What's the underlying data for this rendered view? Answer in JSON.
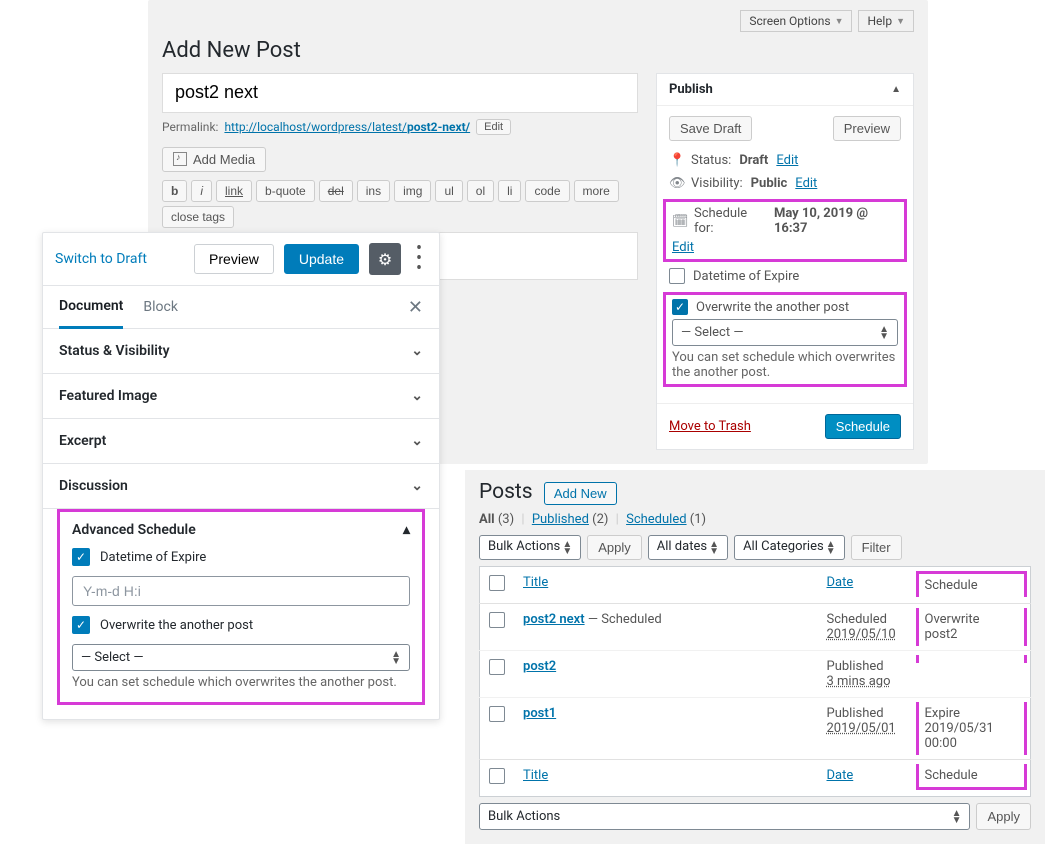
{
  "panel_a": {
    "screen_options": "Screen Options",
    "help": "Help",
    "heading": "Add New Post",
    "title_value": "post2 next",
    "permalink_label": "Permalink:",
    "permalink_base": "http://localhost/wordpress/latest/",
    "permalink_slug": "post2-next/",
    "permalink_edit": "Edit",
    "add_media": "Add Media",
    "quicktags": [
      "b",
      "i",
      "link",
      "b-quote",
      "del",
      "ins",
      "img",
      "ul",
      "ol",
      "li",
      "code",
      "more",
      "close tags"
    ],
    "publish": {
      "title": "Publish",
      "save_draft": "Save Draft",
      "preview": "Preview",
      "status_label": "Status:",
      "status_value": "Draft",
      "status_edit": "Edit",
      "visibility_label": "Visibility:",
      "visibility_value": "Public",
      "visibility_edit": "Edit",
      "schedule_label": "Schedule for:",
      "schedule_value": "May 10, 2019 @ 16:37",
      "schedule_edit": "Edit",
      "datetime_expire_label": "Datetime of Expire",
      "overwrite_label": "Overwrite the another post",
      "select_placeholder": "— Select —",
      "hint": "You can set schedule which overwrites the another post.",
      "move_trash": "Move to Trash",
      "schedule_btn": "Schedule"
    }
  },
  "panel_b": {
    "switch_draft": "Switch to Draft",
    "preview": "Preview",
    "update": "Update",
    "tab_document": "Document",
    "tab_block": "Block",
    "panels": [
      "Status & Visibility",
      "Featured Image",
      "Excerpt",
      "Discussion"
    ],
    "advanced": {
      "title": "Advanced Schedule",
      "datetime_expire_label": "Datetime of Expire",
      "datetime_placeholder": "Y-m-d H:i",
      "overwrite_label": "Overwrite the another post",
      "select_placeholder": "— Select —",
      "hint": "You can set schedule which overwrites the another post."
    }
  },
  "panel_c": {
    "heading": "Posts",
    "add_new": "Add New",
    "filter_all": "All",
    "filter_all_count": "(3)",
    "filter_published": "Published",
    "filter_published_count": "(2)",
    "filter_scheduled": "Scheduled",
    "filter_scheduled_count": "(1)",
    "bulk_actions": "Bulk Actions",
    "apply": "Apply",
    "all_dates": "All dates",
    "all_categories": "All Categories",
    "filter_btn": "Filter",
    "col_title": "Title",
    "col_date": "Date",
    "col_schedule": "Schedule",
    "rows": [
      {
        "title": "post2 next",
        "state": "— Scheduled",
        "date_l1": "Scheduled",
        "date_l2": "2019/05/10",
        "sched_l1": "Overwrite",
        "sched_l2": "post2"
      },
      {
        "title": "post2",
        "state": "",
        "date_l1": "Published",
        "date_l2": "3 mins ago",
        "sched_l1": "",
        "sched_l2": ""
      },
      {
        "title": "post1",
        "state": "",
        "date_l1": "Published",
        "date_l2": "2019/05/01",
        "sched_l1": "Expire",
        "sched_l2": "2019/05/31 00:00"
      }
    ]
  }
}
